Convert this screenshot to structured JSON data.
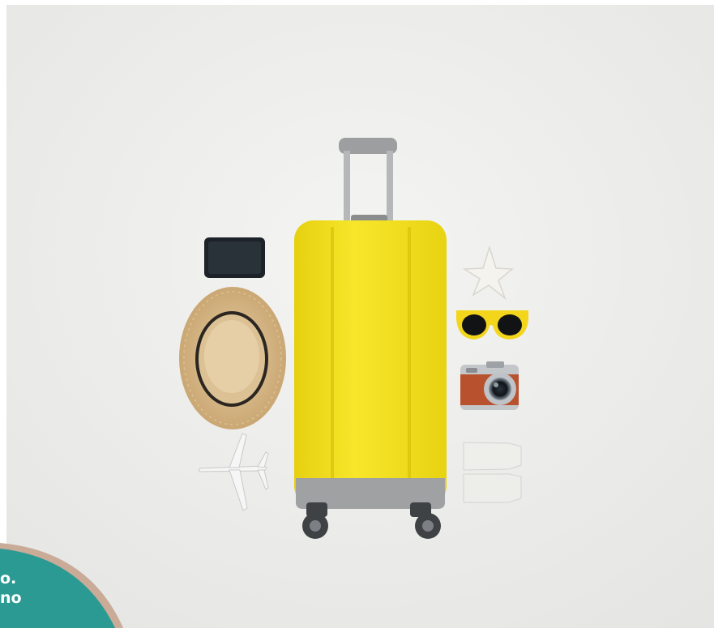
{
  "image": {
    "subject": "travel-flat-lay",
    "items": [
      "tablet-icon",
      "straw-hat-icon",
      "toy-airplane-icon",
      "yellow-suitcase-icon",
      "starfish-icon",
      "yellow-sunglasses-icon",
      "camera-icon",
      "toiletry-tubes-icon"
    ],
    "colors": {
      "background": "#eeeeec",
      "suitcase": "#f3e21b",
      "badge": "#2b9a93",
      "badge_ring": "#c9ab98"
    }
  },
  "badge": {
    "line1": "o.",
    "line2": "no"
  }
}
